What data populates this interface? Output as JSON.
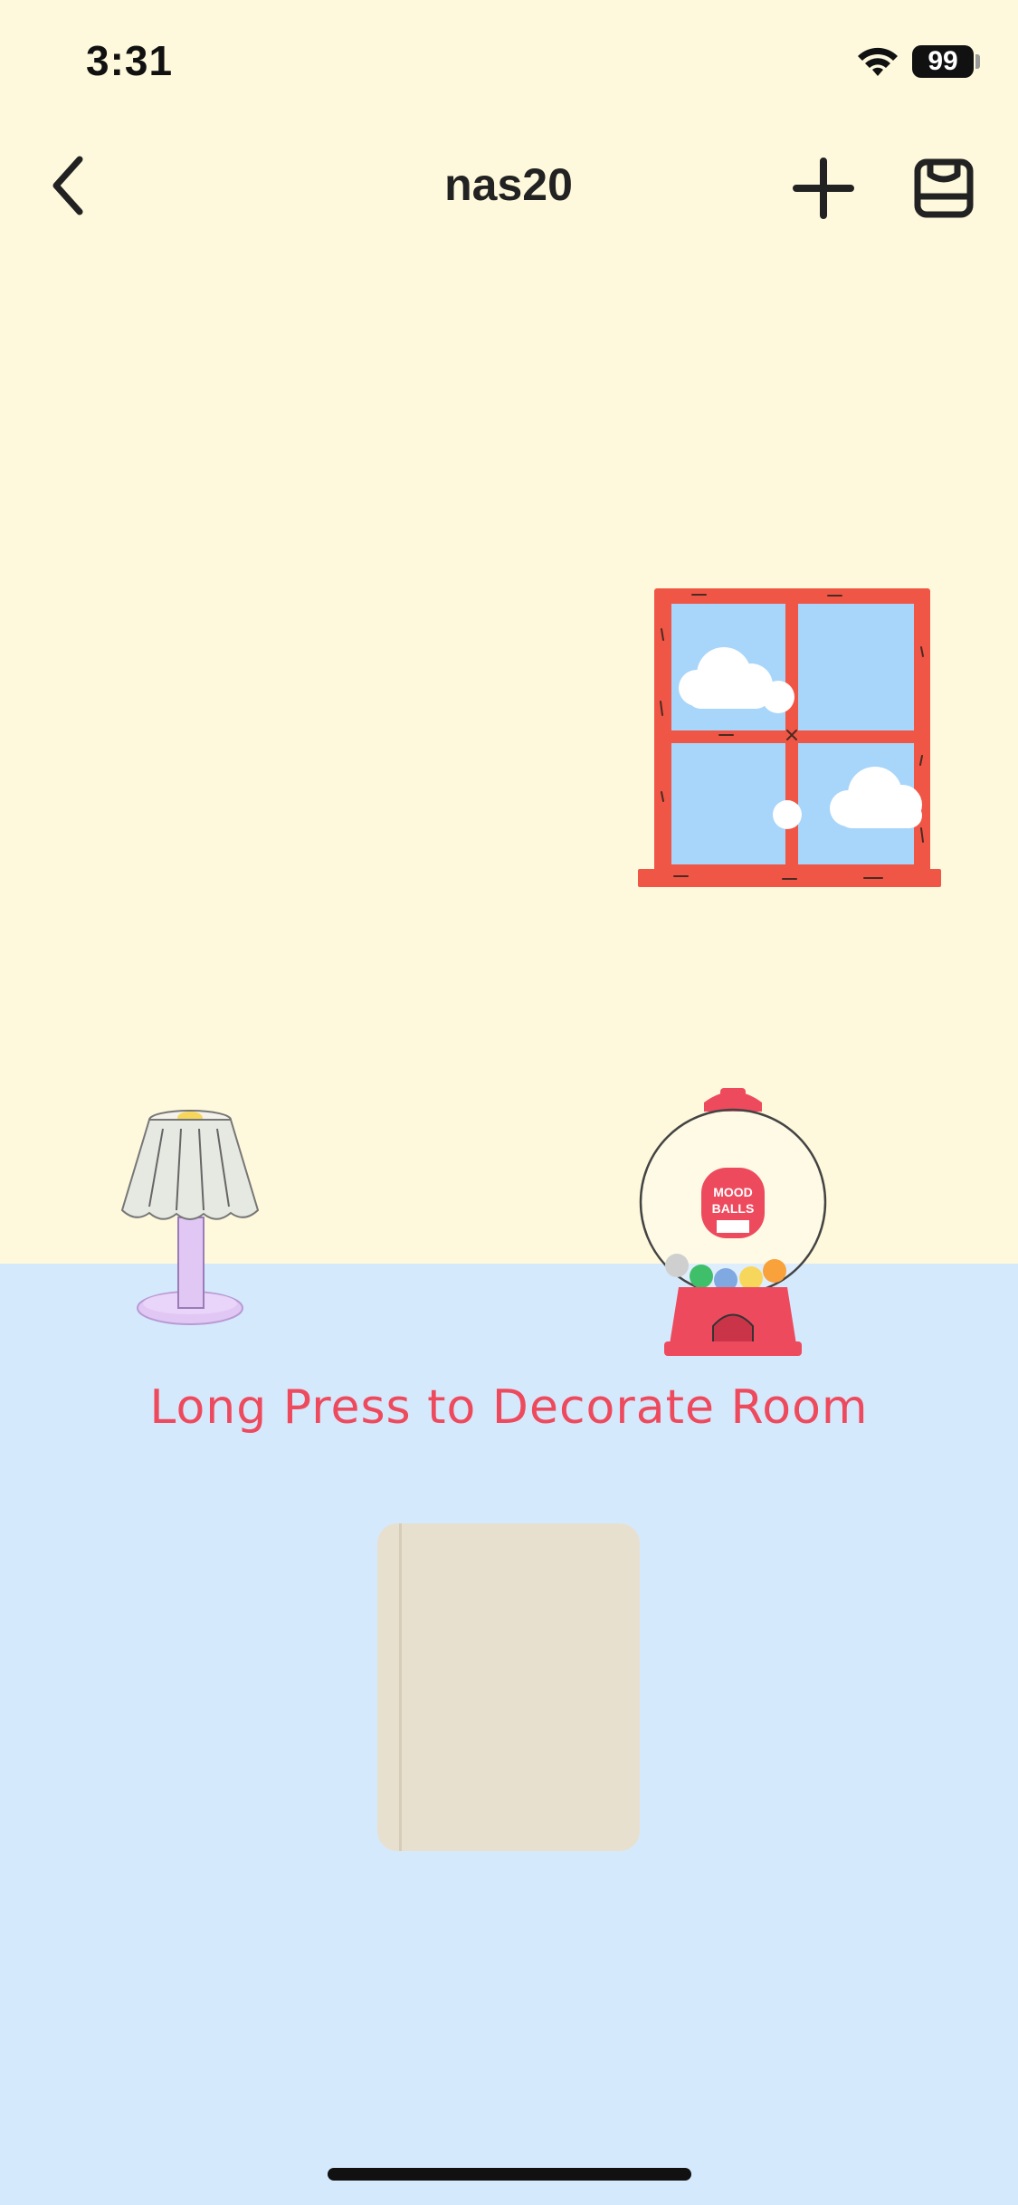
{
  "status_bar": {
    "time": "3:31",
    "battery_level": "99",
    "wifi_icon": "wifi-icon"
  },
  "nav": {
    "title": "nas20",
    "back_icon": "chevron-left-icon",
    "add_icon": "plus-icon",
    "store_icon": "store-bag-icon"
  },
  "room": {
    "wall_color": "#FEF9DC",
    "floor_color": "#D5E9FC",
    "hint": "Long Press to Decorate Room",
    "gumball_label_line1": "MOOD",
    "gumball_label_line2": "BALLS"
  },
  "colors": {
    "accent": "#EE4A5E",
    "window_frame": "#F05645",
    "sky": "#A8D5FA"
  }
}
